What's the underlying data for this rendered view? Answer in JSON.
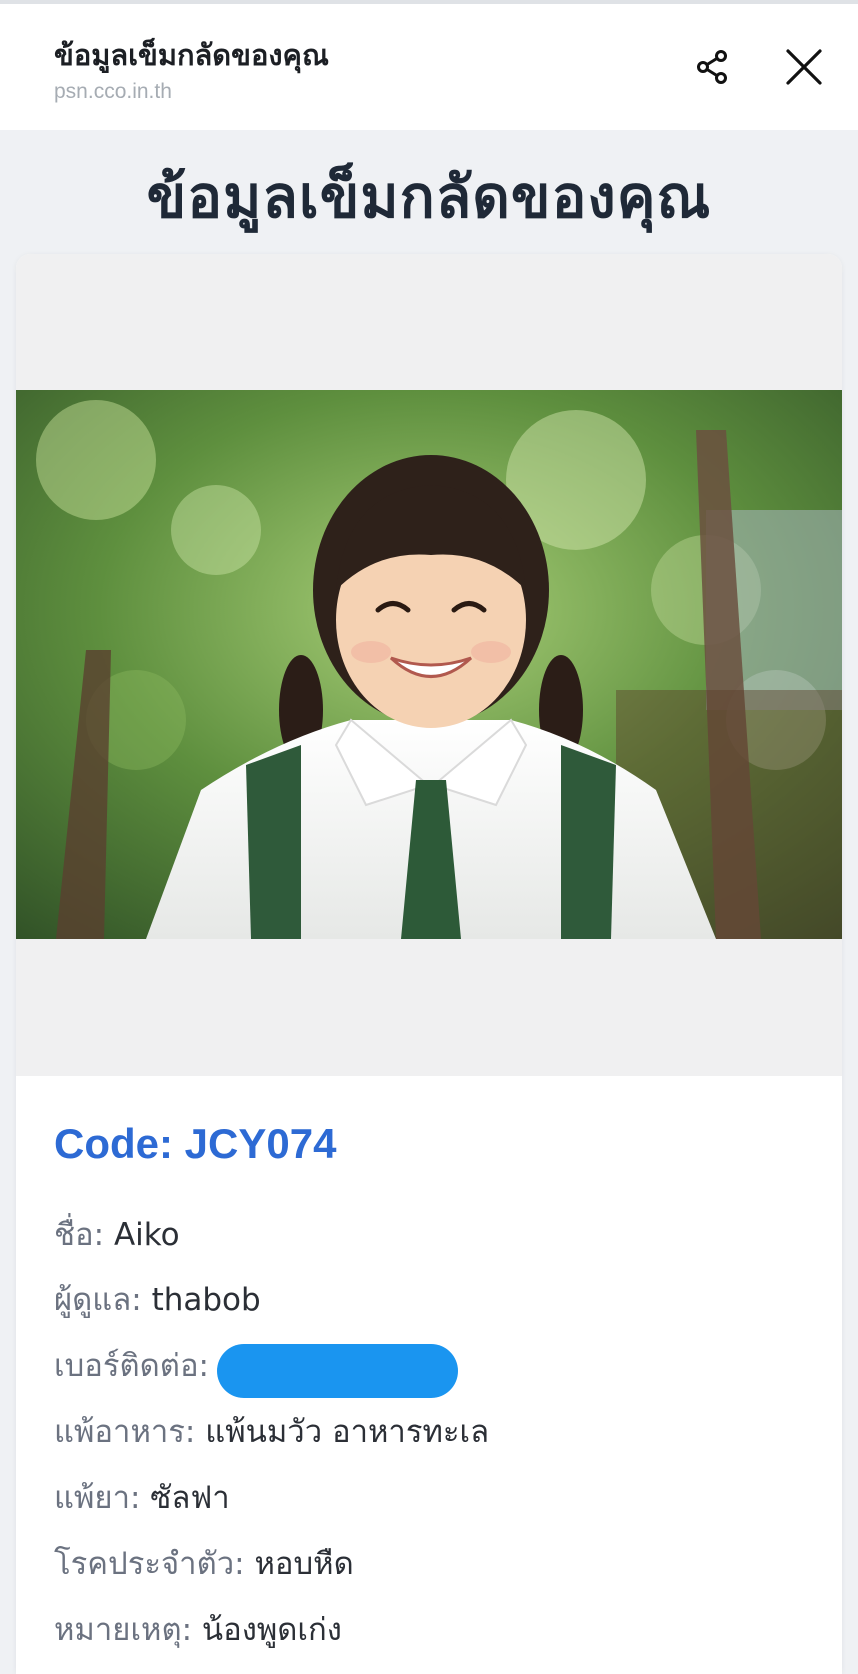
{
  "appbar": {
    "title": "ข้อมูลเข็มกลัดของคุณ",
    "url": "psn.cco.in.th",
    "share_icon": "share-icon",
    "close_icon": "close-icon"
  },
  "page": {
    "heading": "ข้อมูลเข็มกลัดของคุณ"
  },
  "profile": {
    "code": "Code: JCY074",
    "fields": [
      {
        "label": "ชื่อ:",
        "value": "Aiko"
      },
      {
        "label": "ผู้ดูแล:",
        "value": "thabob"
      },
      {
        "label": "เบอร์ติดต่อ:",
        "value": ""
      },
      {
        "label": "แพ้อาหาร:",
        "value": "แพ้นมวัว อาหารทะเล"
      },
      {
        "label": "แพ้ยา:",
        "value": "ซัลฟา"
      },
      {
        "label": "โรคประจำตัว:",
        "value": "หอบหืด"
      },
      {
        "label": "หมายเหตุ:",
        "value": "น้องพูดเก่ง"
      }
    ]
  },
  "colors": {
    "accent": "#2d6ad4",
    "redaction": "#1a95f0",
    "heading": "#1f2937"
  }
}
